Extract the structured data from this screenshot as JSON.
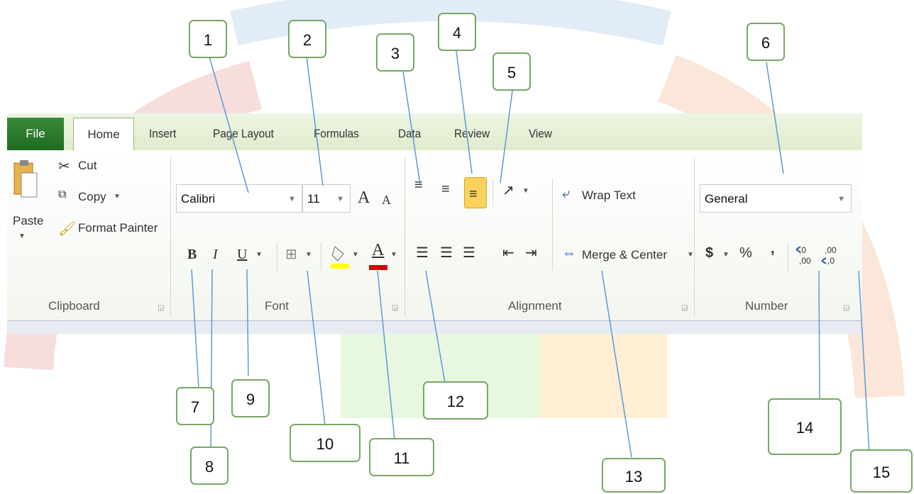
{
  "tabs": [
    "File",
    "Home",
    "Insert",
    "Page Layout",
    "Formulas",
    "Data",
    "Review",
    "View"
  ],
  "clipboard": {
    "paste": "Paste",
    "cut": "Cut",
    "copy": "Copy",
    "format_painter": "Format Painter",
    "group": "Clipboard"
  },
  "font": {
    "name": "Calibri",
    "size": "11",
    "group": "Font",
    "bold": "B",
    "italic": "I",
    "underline": "U",
    "grow": "A",
    "shrink": "A",
    "color": "A"
  },
  "alignment": {
    "wrap": "Wrap Text",
    "merge": "Merge & Center",
    "group": "Alignment"
  },
  "number": {
    "format": "General",
    "currency": "$",
    "percent": "%",
    "comma": ",",
    "group": "Number"
  },
  "callouts": [
    "1",
    "2",
    "3",
    "4",
    "5",
    "6",
    "7",
    "8",
    "9",
    "10",
    "11",
    "12",
    "13",
    "14",
    "15"
  ],
  "colors": {
    "file_tab": "#2b7a2b",
    "callout_border": "#77a865",
    "pointer": "#5b9bd5"
  }
}
